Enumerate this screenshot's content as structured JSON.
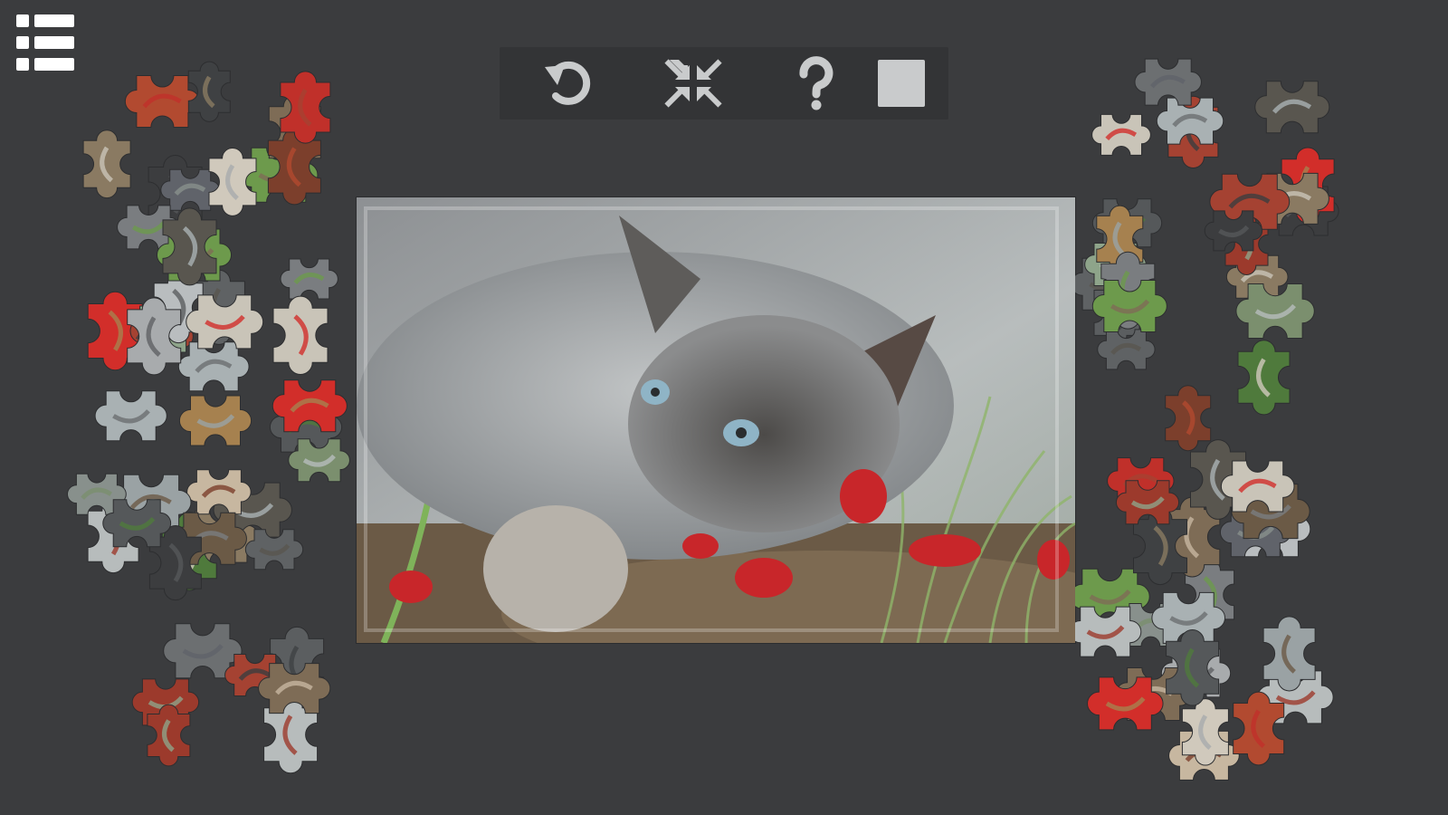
{
  "game": {
    "name": "jigsaw-puzzle",
    "image_subject": "siamese-kitten"
  },
  "menu": {
    "icon": "list-menu-icon"
  },
  "toolbar": {
    "buttons": [
      {
        "id": "undo",
        "icon": "undo-icon"
      },
      {
        "id": "collapse",
        "icon": "collapse-arrows-icon"
      },
      {
        "id": "help",
        "icon": "question-mark-icon"
      },
      {
        "id": "preview",
        "icon": "square-icon"
      }
    ]
  },
  "colors": {
    "background": "#3b3c3e",
    "toolbar": "#333436",
    "icon": "#c9cbcc",
    "kitten_fur": "#9aa0a2",
    "grass": "#6fa84a",
    "petal": "#c8262a",
    "soil": "#7a5a3c"
  },
  "pieces": [
    "#7a7d80",
    "#5f6264",
    "#8a7a62",
    "#a54232",
    "#b7bcbc",
    "#6d9a4c",
    "#59564f",
    "#c9c4b8",
    "#3c3d3f",
    "#9c3a2c",
    "#7e6c56",
    "#a9b1b3",
    "#d22e2a",
    "#55585a",
    "#8ea48a",
    "#c7b7a0",
    "#6c6f71",
    "#a6814f",
    "#4f7a3c",
    "#b9bdbf",
    "#7c3f2c",
    "#60636a",
    "#9aa2a4",
    "#d0c9bc",
    "#5b5e60",
    "#b24a30",
    "#88908c",
    "#6b5a46",
    "#a8abad",
    "#3f4143",
    "#c0302a",
    "#7b8f6e"
  ]
}
